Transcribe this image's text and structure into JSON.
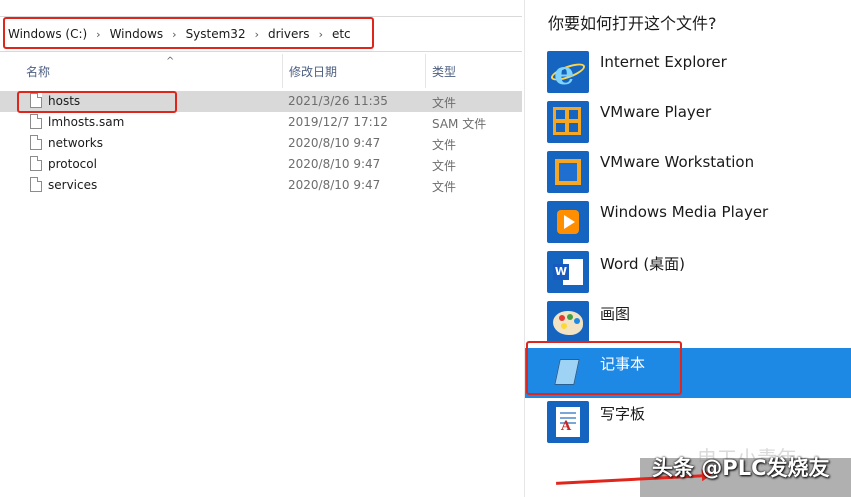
{
  "explorer": {
    "breadcrumb": [
      "Windows (C:)",
      "Windows",
      "System32",
      "drivers",
      "etc"
    ],
    "breadcrumb_separator": "›",
    "columns": {
      "name": "名称",
      "date": "修改日期",
      "type": "类型"
    },
    "files": [
      {
        "name": "hosts",
        "date": "2021/3/26 11:35",
        "type": "文件"
      },
      {
        "name": "lmhosts.sam",
        "date": "2019/12/7 17:12",
        "type": "SAM 文件"
      },
      {
        "name": "networks",
        "date": "2020/8/10 9:47",
        "type": "文件"
      },
      {
        "name": "protocol",
        "date": "2020/8/10 9:47",
        "type": "文件"
      },
      {
        "name": "services",
        "date": "2020/8/10 9:47",
        "type": "文件"
      }
    ]
  },
  "open_with": {
    "title": "你要如何打开这个文件?",
    "apps": [
      {
        "name": "Internet Explorer",
        "icon": "ie-icon"
      },
      {
        "name": "VMware Player",
        "icon": "vmware-player-icon"
      },
      {
        "name": "VMware Workstation",
        "icon": "vmware-workstation-icon"
      },
      {
        "name": "Windows Media Player",
        "icon": "media-player-icon"
      },
      {
        "name": "Word (桌面)",
        "icon": "word-icon"
      },
      {
        "name": "画图",
        "icon": "paint-icon"
      },
      {
        "name": "记事本",
        "icon": "notepad-icon"
      },
      {
        "name": "写字板",
        "icon": "wordpad-icon"
      }
    ]
  },
  "watermark": {
    "text": "头条 @PLC发烧友",
    "faint_text": "电工小青年"
  },
  "colors": {
    "highlight": "#1e88e5",
    "annotation_red": "#e0261c",
    "selected_row": "#d9d9d9"
  }
}
